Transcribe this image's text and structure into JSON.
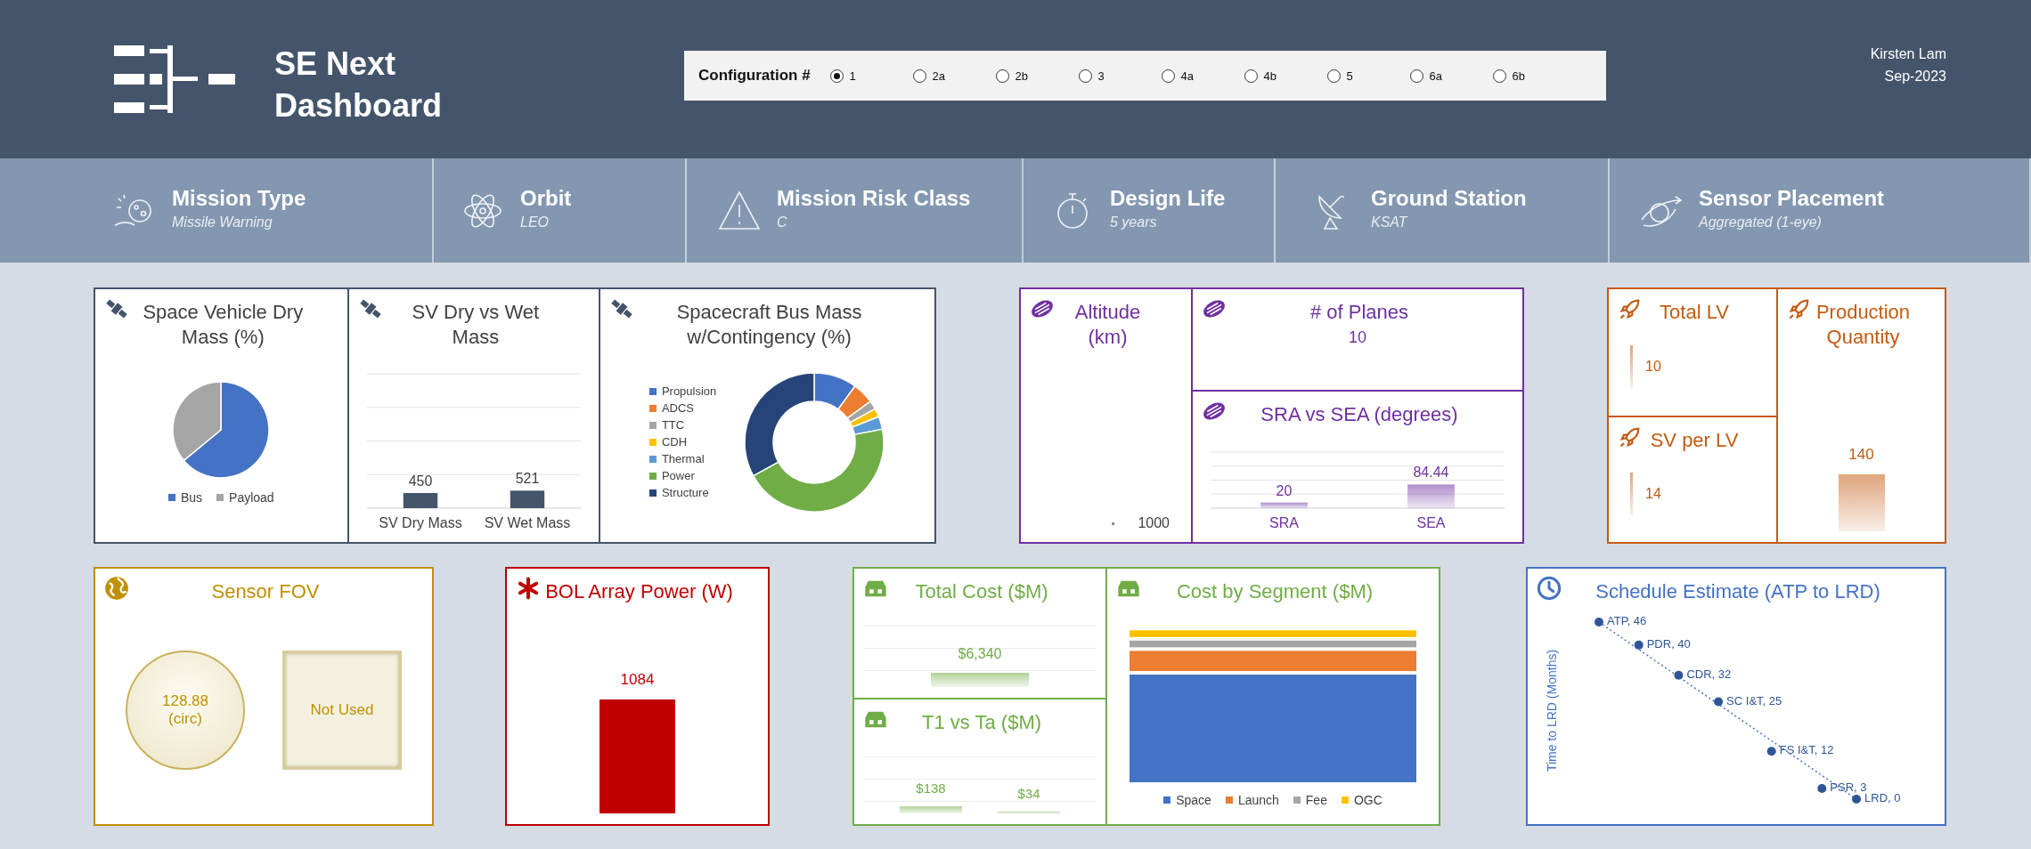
{
  "header": {
    "title": "SE Next Dashboard",
    "configuration": {
      "label": "Configuration #",
      "options": [
        {
          "label": "1",
          "selected": true
        },
        {
          "label": "2a",
          "selected": false
        },
        {
          "label": "2b",
          "selected": false
        },
        {
          "label": "3",
          "selected": false
        },
        {
          "label": "4a",
          "selected": false
        },
        {
          "label": "4b",
          "selected": false
        },
        {
          "label": "5",
          "selected": false
        },
        {
          "label": "6a",
          "selected": false
        },
        {
          "label": "6b",
          "selected": false
        }
      ]
    },
    "user": "Kirsten Lam",
    "date": "Sep-2023"
  },
  "parameters": [
    {
      "title": "Mission Type",
      "value": "Missile Warning"
    },
    {
      "title": "Orbit",
      "value": "LEO"
    },
    {
      "title": "Mission Risk Class",
      "value": "C"
    },
    {
      "title": "Design Life",
      "value": "5 years"
    },
    {
      "title": "Ground Station",
      "value": "KSAT"
    },
    {
      "title": "Sensor Placement",
      "value": "Aggregated (1-eye)"
    }
  ],
  "row_1": [
    {
      "kind": "columns",
      "color": "#44546a",
      "panels": [
        {
          "kind": "pie",
          "title": "Space Vehicle Dry Mass (%)",
          "legend": [
            {
              "label": "Bus",
              "color": "#4472c4"
            },
            {
              "label": "Payload",
              "color": "#a5a5a5"
            }
          ]
        },
        {
          "kind": "bar",
          "title": "SV Dry vs Wet Mass",
          "chart_data": {
            "type": "bar",
            "categories": [
              "SV Dry Mass",
              "SV Wet Mass"
            ],
            "values": [
              450,
              521
            ],
            "ylim": [
              0,
              4000
            ],
            "data_labels": true
          }
        },
        {
          "kind": "donut",
          "title": "Spacecraft Bus Mass w/Contingency (%)",
          "legend": [
            {
              "label": "Propulsion",
              "color": "#4472c4"
            },
            {
              "label": "ADCS",
              "color": "#ed7d31"
            },
            {
              "label": "TTC",
              "color": "#a5a5a5"
            },
            {
              "label": "CDH",
              "color": "#ffc000"
            },
            {
              "label": "Thermal",
              "color": "#5b9bd5"
            },
            {
              "label": "Power",
              "color": "#70ad47"
            },
            {
              "label": "Structure",
              "color": "#264478"
            }
          ]
        }
      ]
    },
    {
      "kind": "split_right",
      "color": "#7030a0",
      "panels": [
        {
          "kind": "dot_value",
          "title": "Altitude (km)",
          "value": "1000"
        },
        {
          "kind": "value",
          "title": "# of Planes",
          "value": "10"
        },
        {
          "kind": "bar",
          "title": "SRA vs SEA (degrees)",
          "chart_data": {
            "type": "bar",
            "categories": [
              "SRA",
              "SEA"
            ],
            "values": [
              20,
              84.44
            ],
            "ylim": [
              0,
              200
            ],
            "data_labels": true
          }
        }
      ]
    },
    {
      "kind": "split_left",
      "color": "#c55a11",
      "panels": [
        {
          "kind": "kpi",
          "title": "Total LV",
          "values": [
            "10"
          ]
        },
        {
          "kind": "kpi",
          "title": "SV per LV",
          "values": [
            "14"
          ]
        },
        {
          "kind": "kpi",
          "title": "Production Quantity",
          "values": [
            "140"
          ]
        }
      ]
    }
  ],
  "row_2": [
    {
      "kind": "single",
      "color": "#bf9000",
      "panels": [
        {
          "kind": "fov",
          "title": "Sensor FOV",
          "circle_text": "128.88\n(circ)",
          "box_text": "Not Used"
        }
      ]
    },
    {
      "kind": "single",
      "color": "#c00000",
      "panels": [
        {
          "kind": "kpi",
          "title": "BOL Array Power (W)",
          "values": [
            "1084"
          ]
        }
      ]
    },
    {
      "kind": "split_left",
      "color": "#70ad47",
      "panels": [
        {
          "kind": "kpi",
          "title": "Total Cost ($M)",
          "values": [
            "$6,340"
          ]
        },
        {
          "kind": "kpi",
          "title": "T1 vs Ta ($M)",
          "values": [
            "$138",
            "$34"
          ]
        },
        {
          "kind": "stacked",
          "title": "Cost by Segment ($M)",
          "legend": [
            {
              "label": "Space",
              "color": "#4472c4"
            },
            {
              "label": "Launch",
              "color": "#ed7d31"
            },
            {
              "label": "Fee",
              "color": "#a5a5a5"
            },
            {
              "label": "OGC",
              "color": "#ffc000"
            }
          ]
        }
      ]
    },
    {
      "kind": "single",
      "color": "#4472c4",
      "panels": [
        {
          "kind": "schedule",
          "title": "Schedule Estimate (ATP to LRD)",
          "axis_title": "Time to LRD (Months)",
          "points": [
            "ATP, 46",
            "PDR, 40",
            "CDR, 32",
            "SC I&T, 25",
            "FS I&T, 12",
            "PSR, 3",
            "LRD, 0"
          ]
        }
      ]
    }
  ]
}
